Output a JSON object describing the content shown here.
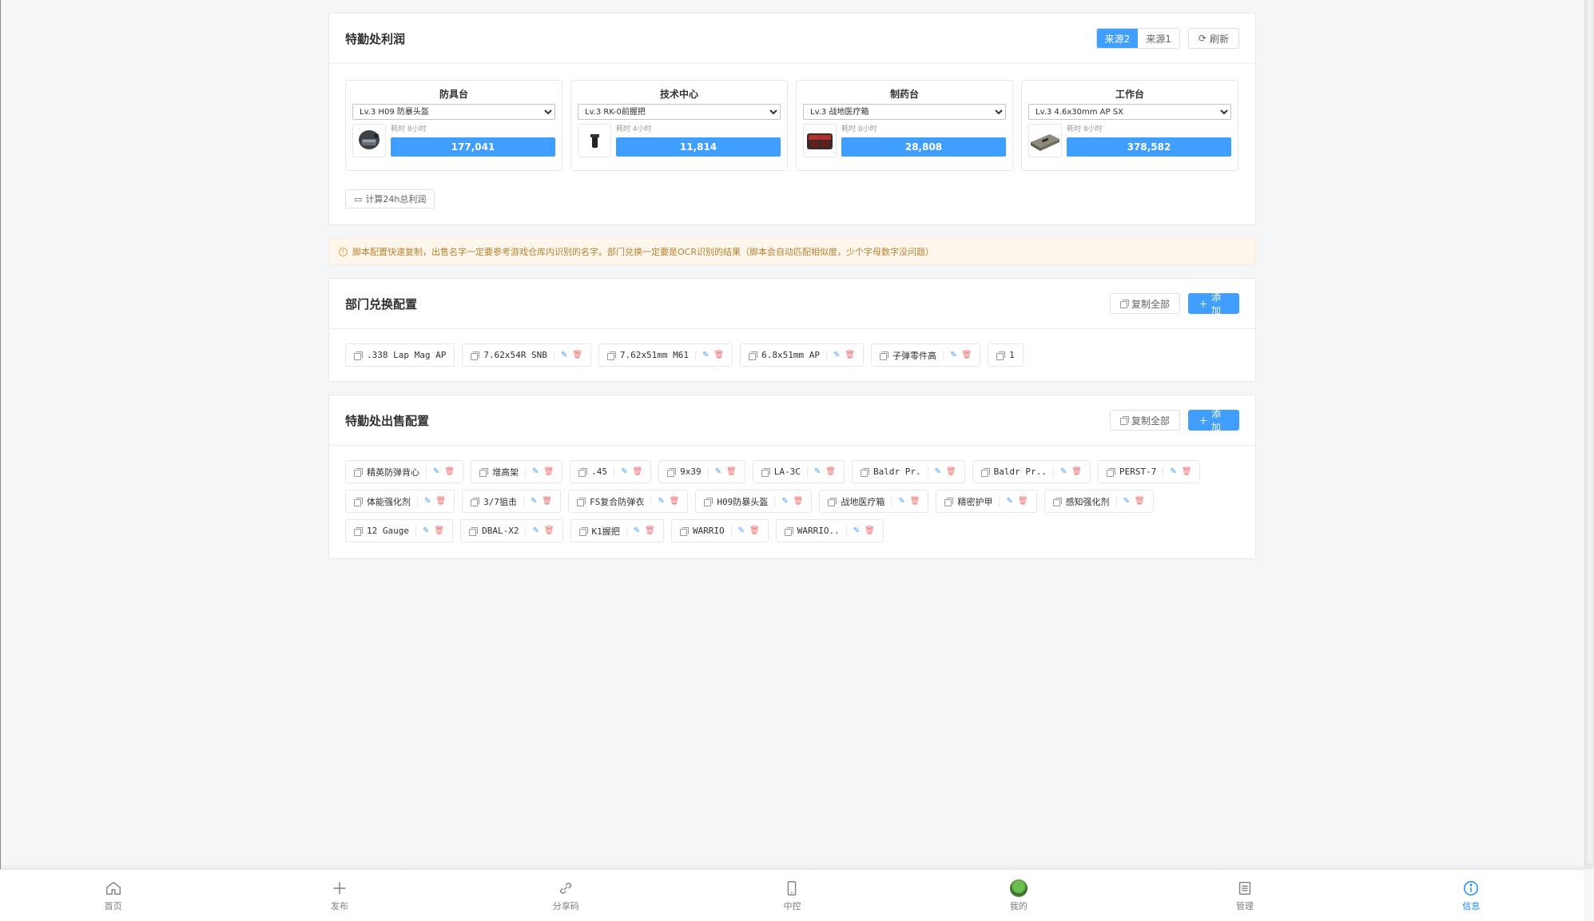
{
  "profit": {
    "title": "特勤处利润",
    "sources": [
      "来源2",
      "来源1"
    ],
    "active_source": "来源2",
    "refresh_label": "刷新",
    "calc_label": "计算24h总利润",
    "stations": [
      {
        "name": "防具台",
        "selected": "Lv.3 H09 防暴头盔",
        "time": "耗时 8小时",
        "profit": "177,041",
        "icon": "helmet-icon"
      },
      {
        "name": "技术中心",
        "selected": "Lv.3 RK-0前握把",
        "time": "耗时 4小时",
        "profit": "11,814",
        "icon": "grip-icon"
      },
      {
        "name": "制药台",
        "selected": "Lv.3 战地医疗箱",
        "time": "耗时 8小时",
        "profit": "28,808",
        "icon": "medkit-icon"
      },
      {
        "name": "工作台",
        "selected": "Lv.3 4.6x30mm AP SX",
        "time": "耗时 8小时",
        "profit": "378,582",
        "icon": "ammo-box-icon"
      }
    ]
  },
  "alert": {
    "text": "脚本配置快速复制，出售名字一定要参考游戏仓库内识别的名字。部门兑换一定要是OCR识别的结果（脚本会自动匹配相似度，少个字母数字没问题）"
  },
  "exchange": {
    "title": "部门兑换配置",
    "copy_all_label": "复制全部",
    "add_label": "添加",
    "items": [
      {
        "name": ".338 Lap Mag AP",
        "editable": false
      },
      {
        "name": "7.62x54R SNB",
        "editable": true
      },
      {
        "name": "7.62x51mm M61",
        "editable": true
      },
      {
        "name": "6.8x51mm AP",
        "editable": true
      },
      {
        "name": "子弹零件高",
        "editable": true
      },
      {
        "name": "1",
        "editable": false
      }
    ]
  },
  "sell": {
    "title": "特勤处出售配置",
    "copy_all_label": "复制全部",
    "add_label": "添加",
    "items": [
      {
        "name": "精英防弹背心"
      },
      {
        "name": "增高架"
      },
      {
        "name": ".45"
      },
      {
        "name": "9x39"
      },
      {
        "name": "LA-3C"
      },
      {
        "name": "Baldr Pr."
      },
      {
        "name": "Baldr Pr.."
      },
      {
        "name": "PERST-7"
      },
      {
        "name": "体能强化剂"
      },
      {
        "name": "3/7狙击"
      },
      {
        "name": "FS复合防弹衣"
      },
      {
        "name": "H09防暴头盔"
      },
      {
        "name": "战地医疗箱"
      },
      {
        "name": "精密护甲"
      },
      {
        "name": "感知强化剂"
      },
      {
        "name": "12 Gauge"
      },
      {
        "name": "DBAL-X2"
      },
      {
        "name": "K1握把"
      },
      {
        "name": "WARRIO"
      },
      {
        "name": "WARRIO.."
      }
    ]
  },
  "tabbar": {
    "active": "信息",
    "tabs": [
      {
        "label": "首页",
        "icon": "home-icon"
      },
      {
        "label": "发布",
        "icon": "plus-icon"
      },
      {
        "label": "分享码",
        "icon": "link-icon"
      },
      {
        "label": "中控",
        "icon": "phone-icon"
      },
      {
        "label": "我的",
        "icon": "avatar"
      },
      {
        "label": "管理",
        "icon": "list-icon"
      },
      {
        "label": "信息",
        "icon": "info-icon"
      }
    ]
  },
  "colors": {
    "primary": "#409eff",
    "warning": "#e6a23c",
    "danger": "#f56c6c",
    "tab_active": "#1989fa"
  }
}
